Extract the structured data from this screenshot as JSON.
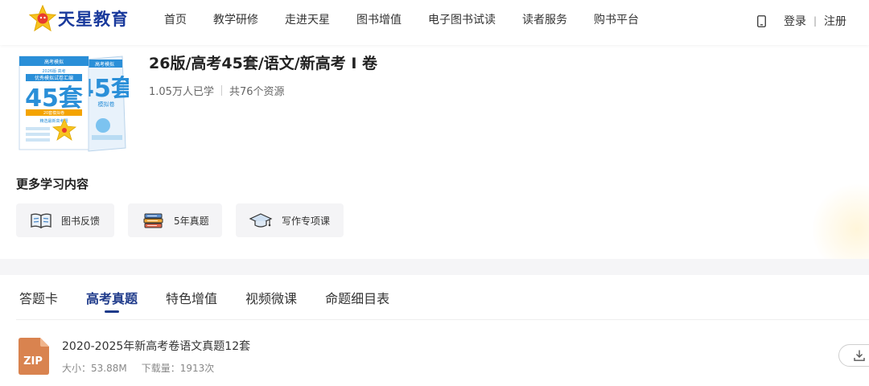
{
  "header": {
    "logo_text": "天星教育",
    "nav": [
      "首页",
      "教学研修",
      "走进天星",
      "图书增值",
      "电子图书试读",
      "读者服务",
      "购书平台"
    ],
    "login": "登录",
    "separator": "|",
    "register": "注册",
    "phone_icon": "mobile-phone-icon"
  },
  "book": {
    "title": "26版/高考45套/语文/新高考 I 卷",
    "learners": "1.05万人已学",
    "resources": "共76个资源",
    "cover": {
      "badge_top": "高考模拟",
      "series": "2026版·高考",
      "subtitle": "优秀模拟试卷汇编",
      "big_number": "45套",
      "ribbon": "20套模拟卷",
      "ribbon2": "精选最新高考题",
      "back_number": "45套",
      "back_sub": "模拟卷"
    }
  },
  "more": {
    "title": "更多学习内容",
    "items": [
      {
        "label": "图书反馈",
        "icon": "book-feedback-icon"
      },
      {
        "label": "5年真题",
        "icon": "stacked-books-icon"
      },
      {
        "label": "写作专项课",
        "icon": "graduation-cap-icon"
      }
    ]
  },
  "tabs": {
    "items": [
      "答题卡",
      "高考真题",
      "特色增值",
      "视频微课",
      "命题细目表"
    ],
    "active_index": 1
  },
  "files": [
    {
      "type_label": "ZIP",
      "name": "2020-2025年新高考卷语文真题12套",
      "size": "大小：53.88M",
      "downloads": "下载量：1913次",
      "download_icon": "download-icon"
    }
  ],
  "colors": {
    "brand_blue": "#1a3a9c",
    "tab_active": "#1e3a8a",
    "zip_orange": "#d9834f",
    "cover_blue": "#2a8fd8",
    "star_yellow": "#f7c320"
  }
}
